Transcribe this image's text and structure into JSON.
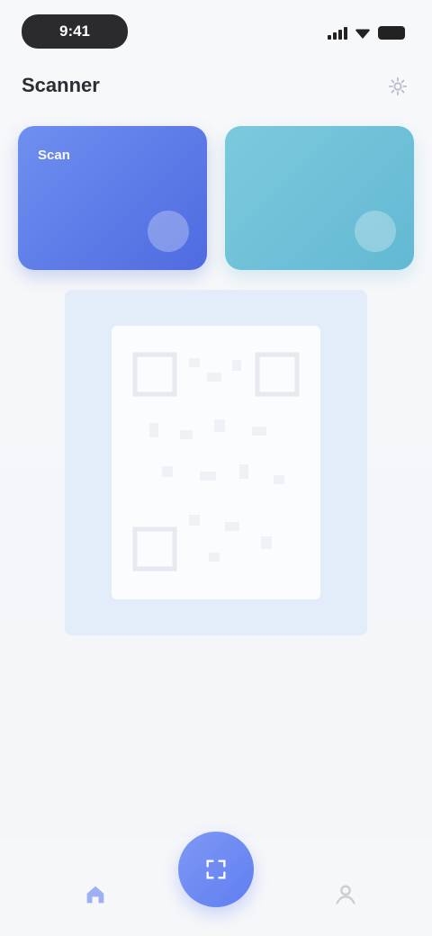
{
  "status": {
    "time": "9:41"
  },
  "header": {
    "title": "Scanner"
  },
  "cards": [
    {
      "title": "Scan",
      "subtitle": "",
      "color": "#5f7ef0"
    },
    {
      "title": "",
      "subtitle": "",
      "color": "#6fc1d8"
    }
  ],
  "description": "",
  "nav": {
    "home_label": "",
    "profile_label": ""
  },
  "icons": {
    "settings": "gear-icon",
    "fab": "qr-scan-icon",
    "home": "home-icon",
    "profile": "user-icon"
  }
}
